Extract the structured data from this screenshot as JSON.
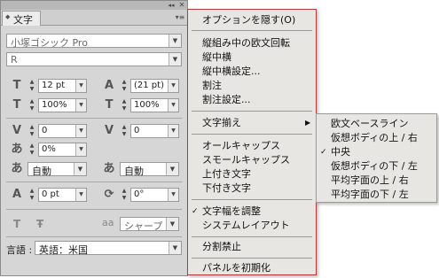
{
  "panel": {
    "tab_label": "文字",
    "tab_arrows_icon": "expand-arrows-icon",
    "collapse_glyph": "◂◂",
    "close_glyph": "✕",
    "menu_glyph": "▾≡",
    "font_family": "小塚ゴシック Pro",
    "font_style": "R",
    "font_size": "12 pt",
    "leading": "(21 pt)",
    "vertical_scale": "100%",
    "horizontal_scale": "100%",
    "kerning": "0",
    "tracking": "0",
    "tsume": "0%",
    "aki_left": "自動",
    "aki_right": "自動",
    "baseline_shift": "0 pt",
    "rotation": "0°",
    "antialias": "シャープ",
    "antialias_label": "aa",
    "language_label": "言語 :",
    "language": "英語：米国"
  },
  "menu": {
    "items": [
      {
        "label": "オプションを隠す(O)",
        "checked": false
      },
      {
        "label": "縦組み中の欧文回転",
        "checked": false
      },
      {
        "label": "縦中横",
        "checked": false
      },
      {
        "label": "縦中横設定...",
        "checked": false
      },
      {
        "label": "割注",
        "checked": false
      },
      {
        "label": "割注設定...",
        "checked": false
      },
      {
        "label": "文字揃え",
        "checked": false,
        "has_submenu": true
      },
      {
        "label": "オールキャップス",
        "checked": false
      },
      {
        "label": "スモールキャップス",
        "checked": false
      },
      {
        "label": "上付き文字",
        "checked": false
      },
      {
        "label": "下付き文字",
        "checked": false
      },
      {
        "label": "文字幅を調整",
        "checked": true
      },
      {
        "label": "システムレイアウト",
        "checked": false
      },
      {
        "label": "分割禁止",
        "checked": false
      },
      {
        "label": "パネルを初期化",
        "checked": false
      }
    ],
    "check_glyph": "✓",
    "submenu_arrow": "▶"
  },
  "submenu": {
    "items": [
      {
        "label": "欧文ベースライン",
        "checked": false
      },
      {
        "label": "仮想ボディの上 / 右",
        "checked": false
      },
      {
        "label": "中央",
        "checked": true
      },
      {
        "label": "仮想ボディの下 / 左",
        "checked": false
      },
      {
        "label": "平均字面の上 / 右",
        "checked": false
      },
      {
        "label": "平均字面の下 / 左",
        "checked": false
      }
    ]
  },
  "colors": {
    "panel_bg": "#d6d6d6",
    "menu_bg": "#e8e6e2",
    "menu_border": "#b33b3b"
  }
}
